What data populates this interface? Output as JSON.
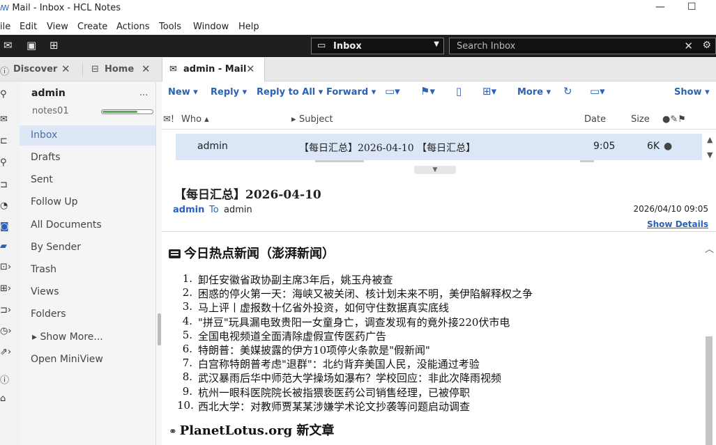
{
  "window": {
    "title": "Mail - Inbox - HCL Notes",
    "minimize_glyph": "—",
    "maximize_glyph": "☐"
  },
  "menu": [
    "ile",
    "Edit",
    "View",
    "Create",
    "Actions",
    "Tools",
    "Window",
    "Help"
  ],
  "darkbar": {
    "db_selector": "Inbox",
    "search_placeholder": "Search Inbox"
  },
  "tabs": [
    {
      "label": "Discover",
      "icon": "info-icon"
    },
    {
      "label": "Home",
      "icon": "home-grid-icon"
    },
    {
      "label": "admin - Mail",
      "icon": "mail-icon"
    }
  ],
  "folders": {
    "account": "admin",
    "more": "...",
    "server": "notes01",
    "quota_fraction": 0.68,
    "items": [
      "Inbox",
      "Drafts",
      "Sent",
      "Follow Up",
      "All Documents",
      "By Sender",
      "Trash",
      "Views",
      "Folders",
      "▸ Show More...",
      "Open MiniView"
    ],
    "selected": "Inbox"
  },
  "actions": {
    "new": "New ▾",
    "reply": "Reply ▾",
    "reply_all": "Reply to All ▾",
    "forward": "Forward ▾",
    "more": "More ▾",
    "show": "Show ▾"
  },
  "columns": {
    "who": "Who ▴",
    "subject": "Subject",
    "date": "Date",
    "size": "Size"
  },
  "message": {
    "who": "admin",
    "subject": "【每日汇总】2026-04-10 【每日汇总】",
    "date": "9:05",
    "size": "6K"
  },
  "preview": {
    "subject": "【每日汇总】2026-04-10",
    "from": "admin",
    "to_label": "To",
    "to": "admin",
    "datetime": "2026/04/10 09:05",
    "show_details": "Show Details"
  },
  "body": {
    "section1_title": "今日热点新闻（澎湃新闻）",
    "news": [
      {
        "n": "1.",
        "text": "卸任安徽省政协副主席3年后，姚玉舟被查"
      },
      {
        "n": "2.",
        "text": "困惑的停火第一天：海峡又被关闭、核计划未来不明，美伊陷解释权之争"
      },
      {
        "n": "3.",
        "text": "马上评丨虚报数十亿省外投资，如何守住数据真实底线"
      },
      {
        "n": "4.",
        "text": "\"拼豆\"玩具漏电致贵阳一女童身亡，调查发现有的竟外接220伏市电"
      },
      {
        "n": "5.",
        "text": "全国电视频道全面清除虚假宣传医药广告"
      },
      {
        "n": "6.",
        "text": "特朗普：美媒披露的伊方10项停火条款是\"假新闻\""
      },
      {
        "n": "7.",
        "text": "白宫称特朗普考虑\"退群\"：北约背弃美国人民，没能通过考验"
      },
      {
        "n": "8.",
        "text": "武汉暴雨后华中师范大学操场如瀑布？学校回应：非此次降雨视频"
      },
      {
        "n": "9.",
        "text": "杭州一眼科医院院长被指猥亵医药公司销售经理，已被停职"
      },
      {
        "n": "10.",
        "text": "西北大学：对教师贾某某涉嫌学术论文抄袭等问题启动调查"
      }
    ],
    "section2_title": "PlanetLotus.org 新文章"
  },
  "colors": {
    "accent": "#2a62b6",
    "darkbar": "#1f1f1f",
    "selection": "#dbe6f7",
    "quota": "#4caf50"
  }
}
